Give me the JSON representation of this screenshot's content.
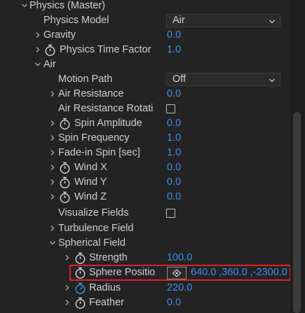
{
  "rows": [
    {
      "label": "Physics (Master)"
    },
    {
      "label": "Physics Model",
      "value": "Air"
    },
    {
      "label": "Gravity",
      "value": "0.0"
    },
    {
      "label": "Physics Time Factor",
      "value": "1.0"
    },
    {
      "label": "Air"
    },
    {
      "label": "Motion Path",
      "value": "Off"
    },
    {
      "label": "Air Resistance",
      "value": "0.0"
    },
    {
      "label": "Air Resistance Rotati"
    },
    {
      "label": "Spin Amplitude",
      "value": "0.0"
    },
    {
      "label": "Spin Frequency",
      "value": "1.0"
    },
    {
      "label": "Fade-in Spin [sec]",
      "value": "1.0"
    },
    {
      "label": "Wind X",
      "value": "0.0"
    },
    {
      "label": "Wind Y",
      "value": "0.0"
    },
    {
      "label": "Wind Z",
      "value": "0.0"
    },
    {
      "label": "Visualize Fields"
    },
    {
      "label": "Turbulence Field"
    },
    {
      "label": "Spherical Field"
    },
    {
      "label": "Strength",
      "value": "100.0"
    },
    {
      "label": "Sphere Positio",
      "value": "640.0 ,360.0 ,-2300.0"
    },
    {
      "label": "Radius",
      "value": "220.0"
    },
    {
      "label": "Feather",
      "value": "0.0"
    }
  ],
  "colors": {
    "background": "#232323",
    "label": "#cfcfcf",
    "value_blue": "#3d8ee8",
    "highlight_red": "#e01f26"
  },
  "icons": {
    "expanded": "chevron-down-icon",
    "collapsed": "chevron-right-icon",
    "stopwatch": "stopwatch-icon",
    "stopwatch_active": "stopwatch-active-icon",
    "dropdown": "dropdown-arrow-icon",
    "target": "target-icon"
  },
  "checkboxes": {
    "air_resistance_rotation": false,
    "visualize_fields": false
  }
}
